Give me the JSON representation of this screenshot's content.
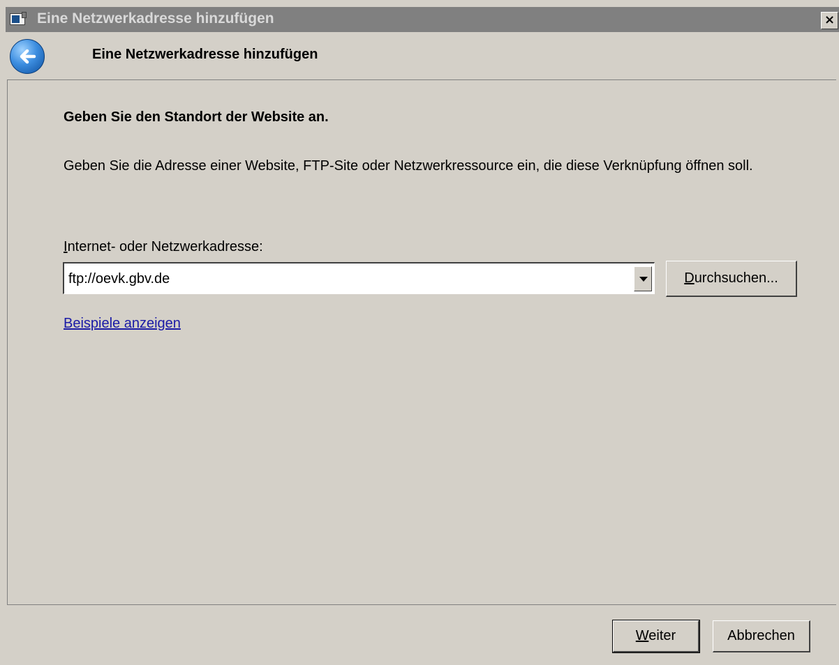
{
  "window": {
    "title": "Eine Netzwerkadresse hinzufügen",
    "close_glyph": "×"
  },
  "header": {
    "title": "Eine Netzwerkadresse hinzufügen"
  },
  "content": {
    "heading": "Geben Sie den Standort der Website an.",
    "description": "Geben Sie die Adresse einer Website, FTP-Site oder Netzwerkressource ein, die diese Verknüpfung öffnen soll.",
    "field_label": "Internet- oder Netzwerkadresse:",
    "address_value": "ftp://oevk.gbv.de",
    "browse_label": "Durchsuchen...",
    "examples_link": "Beispiele anzeigen"
  },
  "footer": {
    "next_label": "Weiter",
    "cancel_label": "Abbrechen"
  },
  "colors": {
    "dialog_background": "#d4d0c8",
    "title_bar_inactive": "#808080",
    "link": "#1a1aa6"
  },
  "icons": {
    "app": "window-app-icon",
    "back": "back-arrow-icon",
    "close": "close-icon",
    "dropdown": "chevron-down-icon"
  }
}
